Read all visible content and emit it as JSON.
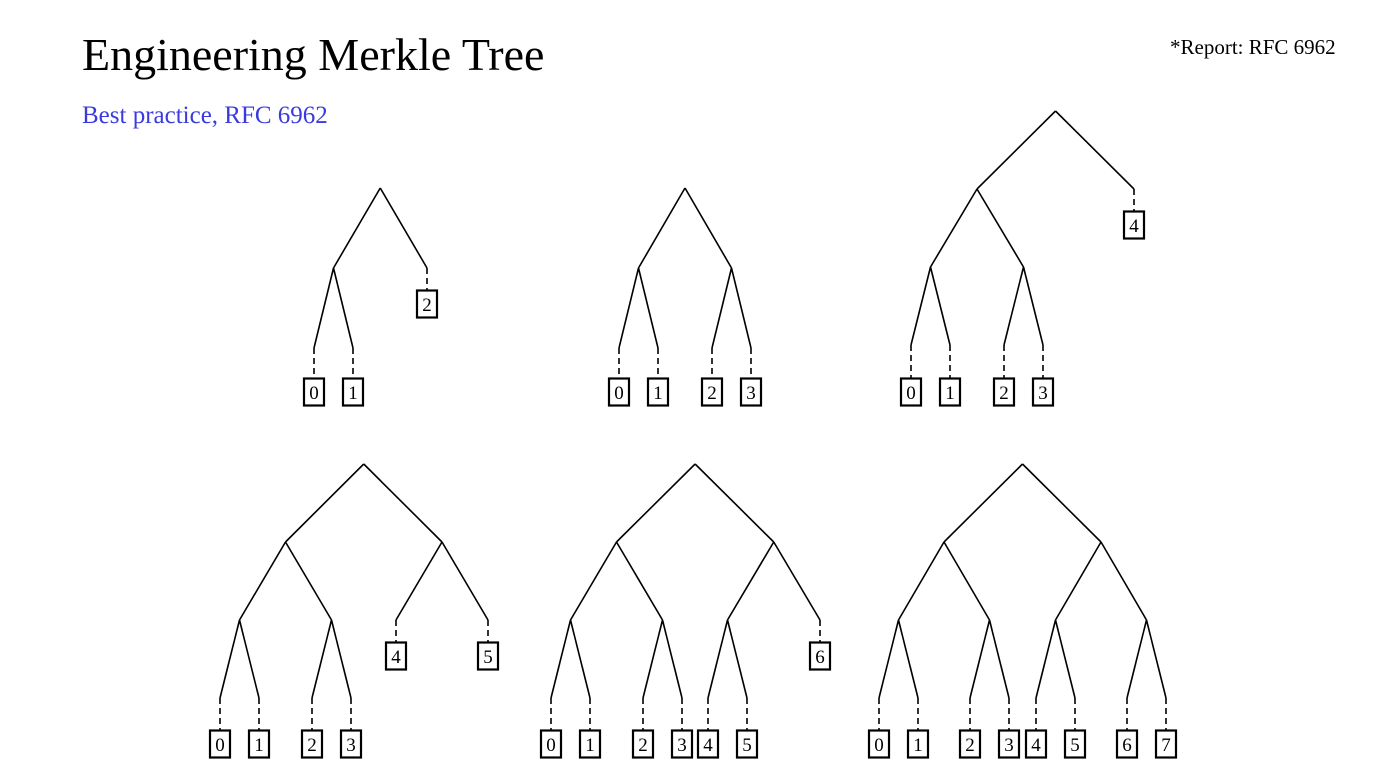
{
  "header": {
    "title": "Engineering Merkle Tree",
    "subtitle": "Best practice, RFC 6962",
    "report_note": "*Report: RFC 6962"
  },
  "diagrams": [
    {
      "leaves": [
        "0",
        "1",
        "2"
      ]
    },
    {
      "leaves": [
        "0",
        "1",
        "2",
        "3"
      ]
    },
    {
      "leaves": [
        "0",
        "1",
        "2",
        "3",
        "4"
      ]
    },
    {
      "leaves": [
        "0",
        "1",
        "2",
        "3",
        "4",
        "5"
      ]
    },
    {
      "leaves": [
        "0",
        "1",
        "2",
        "3",
        "4",
        "5",
        "6"
      ]
    },
    {
      "leaves": [
        "0",
        "1",
        "2",
        "3",
        "4",
        "5",
        "6",
        "7"
      ]
    }
  ],
  "colors": {
    "subtitle": "#3a3adf",
    "lines": "#000000"
  }
}
